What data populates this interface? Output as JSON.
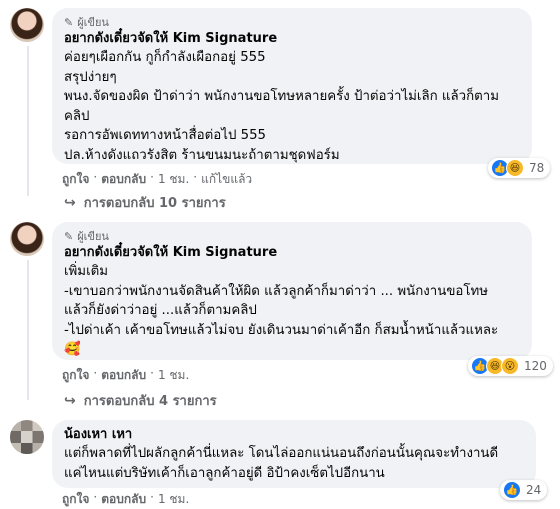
{
  "comments": [
    {
      "badge": "ผู้เขียน",
      "author": "อยากดังเดี๋ยวจัดให้ Kim Signature",
      "lines": [
        "ค่อยๆเผือกกัน กูก็กำลังเผือกอยู่ 555",
        "สรุปง่ายๆ",
        "พนง.จัดของผิด ป้าด่าว่า พนักงานขอโทษหลายครั้ง ป้าต่อว่าไม่เลิก แล้วก็ตาม",
        "คลิป",
        "รอการอัพเดททางหน้าสื่อต่อไป 555",
        "ปล.ห้างดังแถวรังสิต ร้านขนมนะถ้าตามชุดฟอร์ม"
      ],
      "actions": [
        "ถูกใจ",
        "ตอบกลับ",
        "1 ชม.",
        "แก้ไขแล้ว"
      ],
      "reaction_count": "78",
      "replies_label": "การตอบกลับ 10 รายการ"
    },
    {
      "badge": "ผู้เขียน",
      "author": "อยากดังเดี๋ยวจัดให้ Kim Signature",
      "lines": [
        "เพิ่มเติม",
        "-เขาบอกว่าพนักงานจัดสินค้าให้ผิด แล้วลูกค้าก็มาด่าว่า ... พนักงานขอโทษ",
        "แล้วก็ยังด่าว่าอยู่ ...แล้วก็ตามคลิป",
        "-ไปด่าเค้า เค้าขอโทษแล้วไม่จบ ยังเดินวนมาด่าเค้าอีก ก็สมน้ำหน้าแล้วแหละ",
        "🥰"
      ],
      "actions": [
        "ถูกใจ",
        "ตอบกลับ",
        "1 ชม."
      ],
      "reaction_count": "120",
      "replies_label": "การตอบกลับ 4 รายการ"
    },
    {
      "author": "น้องเหา เหา",
      "lines": [
        "แต่ก็พลาดที่ไปผลักลูกค้านี่แหละ โดนไล่ออกแน่นอนถึงก่อนนั้นคุณจะทำงานดี",
        "แค่ไหนแต่บริษัทเค้าก็เอาลูกค้าอยู่ดี อิป้าคงเซ็ตไปอีกนาน"
      ],
      "actions": [
        "ถูกใจ",
        "ตอบกลับ",
        "1 ชม."
      ],
      "reaction_count": "24"
    }
  ],
  "icons": {
    "badge": "pen-icon",
    "like": "like-icon",
    "haha": "haha-icon",
    "wow": "wow-icon",
    "reply_arrow": "reply-arrow-icon"
  },
  "colors": {
    "bubble": "#f0f2f5",
    "muted": "#65676b",
    "like_blue": "#1877f2",
    "emoji_yellow": "#f7b928"
  }
}
